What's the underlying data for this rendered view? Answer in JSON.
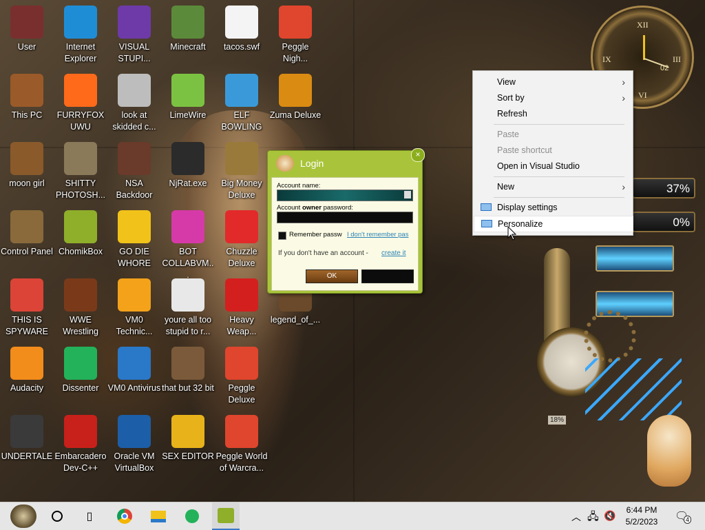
{
  "desktop_icons": [
    {
      "label": "User",
      "icon": "user-folder-icon",
      "color": "#7a2f2f"
    },
    {
      "label": "Internet Explorer",
      "icon": "edge-icon",
      "color": "#1f8dd6"
    },
    {
      "label": "VISUAL STUPI...",
      "icon": "visual-studio-icon",
      "color": "#6d3aa8"
    },
    {
      "label": "Minecraft",
      "icon": "minecraft-icon",
      "color": "#5b8a3a"
    },
    {
      "label": "tacos.swf",
      "icon": "flash-file-icon",
      "color": "#f4f4f4"
    },
    {
      "label": "Peggle Nigh...",
      "icon": "peggle-icon",
      "color": "#e0452d"
    },
    {
      "label": "This PC",
      "icon": "computer-icon",
      "color": "#9b5a2a"
    },
    {
      "label": "FURRYFOX UWU",
      "icon": "firefox-icon",
      "color": "#ff6a1a"
    },
    {
      "label": "look at skidded c...",
      "icon": "copy-icon",
      "color": "#bdbdbd"
    },
    {
      "label": "LimeWire",
      "icon": "limewire-icon",
      "color": "#7cc242"
    },
    {
      "label": "ELF BOWLING",
      "icon": "elf-icon",
      "color": "#3a9ad9"
    },
    {
      "label": "Zuma Deluxe",
      "icon": "zuma-icon",
      "color": "#d98b12"
    },
    {
      "label": "moon girl",
      "icon": "book-icon",
      "color": "#8a5a2a"
    },
    {
      "label": "SHITTY PHOTOSH...",
      "icon": "gimp-icon",
      "color": "#8a7a5a"
    },
    {
      "label": "NSA Backdoor",
      "icon": "app-icon",
      "color": "#6a3a2a"
    },
    {
      "label": "NjRat.exe",
      "icon": "skull-icon",
      "color": "#2b2b2b"
    },
    {
      "label": "Big Money Deluxe",
      "icon": "money-bag-icon",
      "color": "#9a7a3a"
    },
    {
      "label": "Control Panel",
      "icon": "control-panel-icon",
      "color": "#8a6a3a"
    },
    {
      "label": "ChomikBox",
      "icon": "chomikbox-icon",
      "color": "#8fae2a"
    },
    {
      "label": "GO DIE WHORE",
      "icon": "de-icon",
      "color": "#f1c21a"
    },
    {
      "label": "BOT COLLABVM...",
      "icon": "film-icon",
      "color": "#d63aa8"
    },
    {
      "label": "Chuzzle Deluxe",
      "icon": "chuzzle-icon",
      "color": "#e22a2a"
    },
    {
      "label": "THIS IS SPYWARE",
      "icon": "chrome-icon",
      "color": "#db4437"
    },
    {
      "label": "WWE Wrestling",
      "icon": "tv-icon",
      "color": "#7a3a1a"
    },
    {
      "label": "VM0 Technic...",
      "icon": "agent-icon",
      "color": "#f3a21a"
    },
    {
      "label": "youre all too stupid to r...",
      "icon": "portrait-icon",
      "color": "#e8e8e8"
    },
    {
      "label": "Heavy Weap...",
      "icon": "radiation-icon",
      "color": "#d41f1f"
    },
    {
      "label": "legend_of_...",
      "icon": "sprite-icon",
      "color": "#6a4a2a"
    },
    {
      "label": "Audacity",
      "icon": "audacity-icon",
      "color": "#f28c1a"
    },
    {
      "label": "Dissenter",
      "icon": "dissenter-icon",
      "color": "#23b25a"
    },
    {
      "label": "VM0 Antivirus",
      "icon": "shield-icon",
      "color": "#2a78c8"
    },
    {
      "label": "that but 32 bit",
      "icon": "portrait-icon",
      "color": "#7a5a3a"
    },
    {
      "label": "Peggle Deluxe",
      "icon": "peggle-icon",
      "color": "#e0452d"
    },
    {
      "label": "UNDERTALE",
      "icon": "unity-icon",
      "color": "#3a3a3a"
    },
    {
      "label": "Embarcadero Dev-C++",
      "icon": "devcpp-icon",
      "color": "#c8201a"
    },
    {
      "label": "Oracle VM VirtualBox",
      "icon": "virtualbox-icon",
      "color": "#1d5ea8"
    },
    {
      "label": "SEX EDITOR",
      "icon": "hxd-icon",
      "color": "#e8b21a"
    },
    {
      "label": "Peggle World of Warcra...",
      "icon": "peggle-icon",
      "color": "#e0452d"
    }
  ],
  "context_menu": {
    "items": [
      {
        "label": "View",
        "submenu": true,
        "disabled": false
      },
      {
        "label": "Sort by",
        "submenu": true,
        "disabled": false
      },
      {
        "label": "Refresh",
        "submenu": false,
        "disabled": false
      },
      {
        "label": "Paste",
        "submenu": false,
        "disabled": true
      },
      {
        "label": "Paste shortcut",
        "submenu": false,
        "disabled": true
      },
      {
        "label": "Open in Visual Studio",
        "submenu": false,
        "disabled": false
      },
      {
        "label": "New",
        "submenu": true,
        "disabled": false
      },
      {
        "label": "Display settings",
        "submenu": false,
        "disabled": false
      },
      {
        "label": "Personalize",
        "submenu": false,
        "disabled": false
      }
    ]
  },
  "login": {
    "title": "Login",
    "close_glyph": "×",
    "account_label": "Account name:",
    "password_label_pre": "Account",
    "password_label_bold": "owner",
    "password_label_post": "password:",
    "remember_label": "Remember passw",
    "forgot_link": "I don't remember pas",
    "no_account_text": "If you don't have an account -",
    "create_link": "create it",
    "ok_label": "OK",
    "cancel_label": ""
  },
  "gadgets": {
    "cpu_percent": "37%",
    "ram_percent": "0%",
    "gauge_label": "18%",
    "clock_numerals": [
      "XII",
      "III",
      "VI",
      "IX"
    ],
    "clock_date": "02"
  },
  "taskbar": {
    "time": "6:44 PM",
    "date": "5/2/2023",
    "notification_count": "4",
    "apps": [
      "start-orb-icon",
      "cortana-icon",
      "task-view-icon",
      "chrome-icon",
      "file-explorer-icon",
      "dissenter-icon",
      "chomikbox-icon"
    ]
  }
}
